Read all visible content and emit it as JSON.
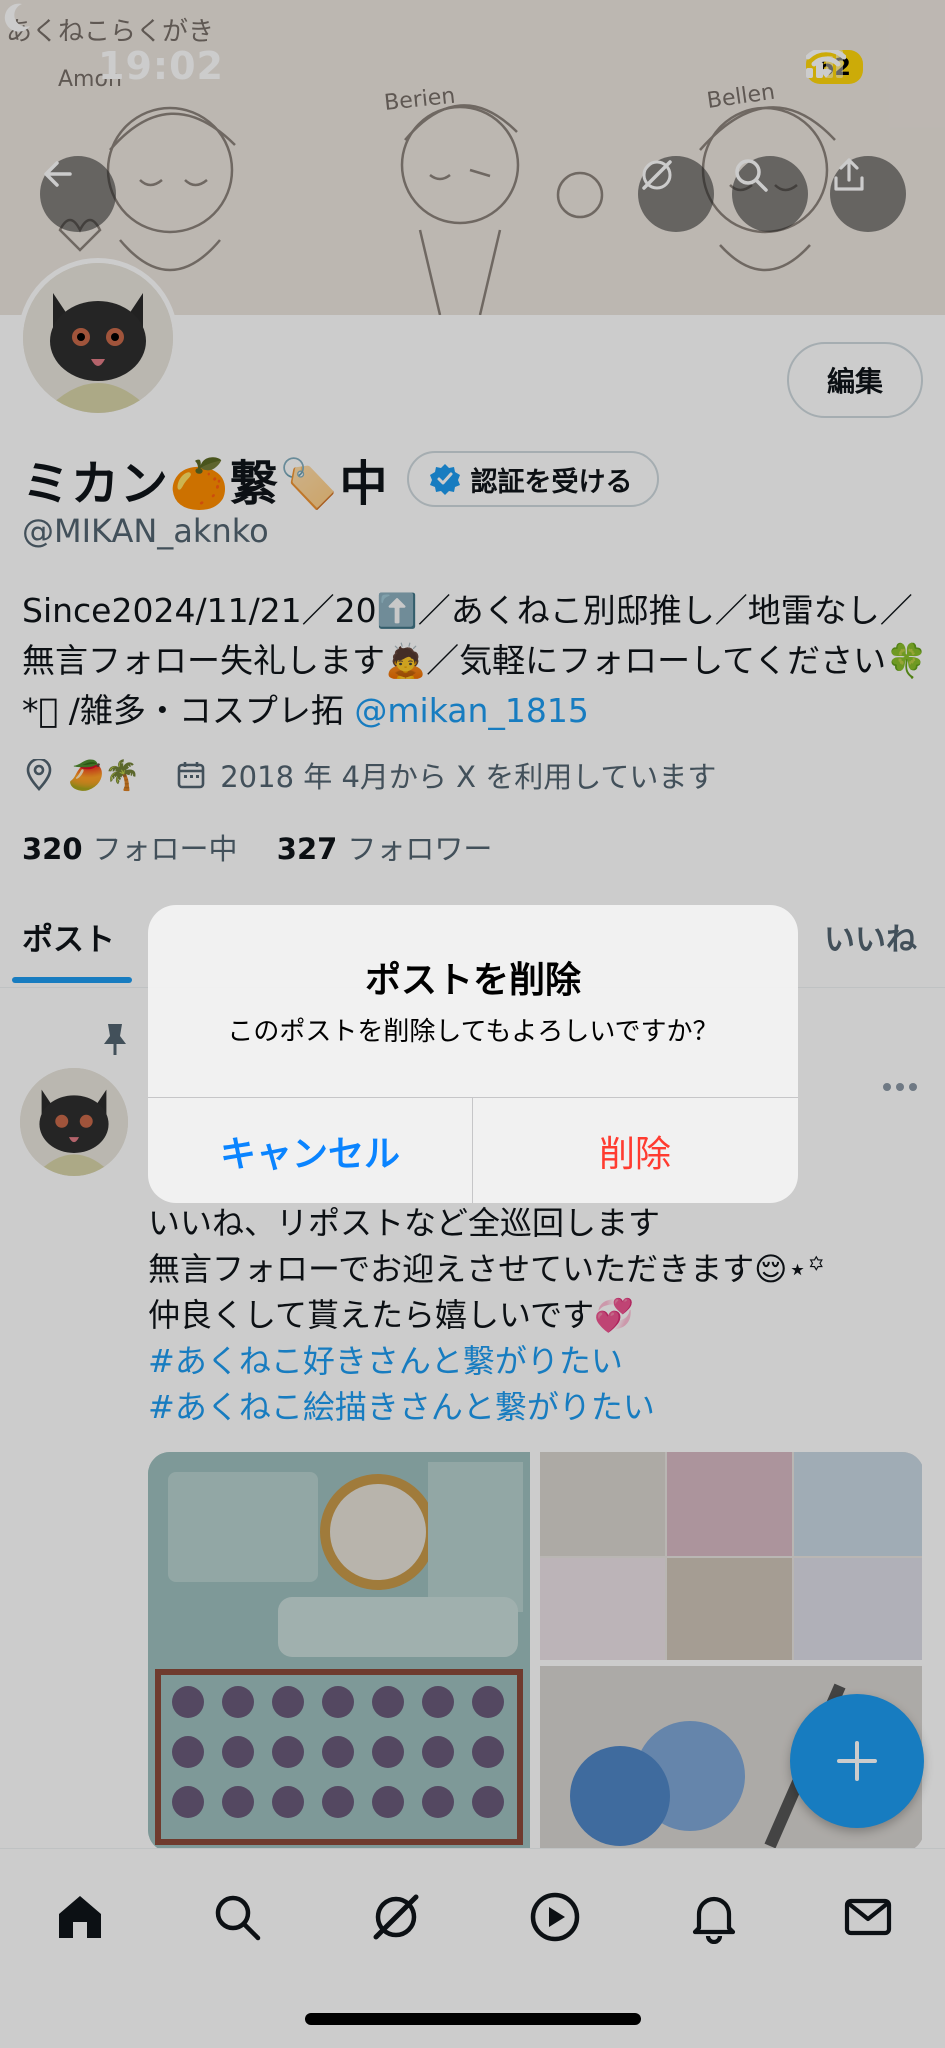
{
  "status_bar": {
    "time": "19:02",
    "battery": "62"
  },
  "banner": {
    "doodle_texts": [
      "あくねこらくがき",
      "Amon",
      "Berien",
      "Bellen"
    ]
  },
  "profile": {
    "name": "ミカン🍊繋🏷️中",
    "verify_label": "認証を受ける",
    "edit_label": "編集",
    "handle": "@MIKAN_aknko",
    "bio_text": "Since2024/11/21／20⬆️／あくねこ別邸推し／地雷なし／無言フォロー失礼します🙇／気軽にフォローしてください🍀*ﾟ /雑多・コスプレ拓 ",
    "bio_link": "@mikan_1815",
    "location": "🥭🌴",
    "joined": "2018 年 4月から X を利用しています",
    "following_count": "320",
    "following_label": "フォロー中",
    "followers_count": "327",
    "followers_label": "フォロワー"
  },
  "tabs": {
    "posts": "ポスト",
    "likes": "いいね"
  },
  "post": {
    "lines": [
      "いいね、リポストなど全巡回します",
      "無言フォローでお迎えさせていただきます😌⋆꙳",
      "仲良くして貰えたら嬉しいです💞"
    ],
    "hashtags": [
      "#あくねこ好きさんと繋がりたい",
      " #あくねこ絵描きさんと繋がりたい"
    ]
  },
  "dialog": {
    "title": "ポストを削除",
    "message": "このポストを削除してもよろしいですか？",
    "cancel": "キャンセル",
    "delete": "削除"
  },
  "colors": {
    "accent": "#1d9bf0",
    "danger": "#ff3b30",
    "ios_blue": "#0a84ff",
    "battery": "#ffd60a"
  },
  "icons": [
    "back-arrow-icon",
    "grok-icon",
    "search-icon",
    "share-icon",
    "verified-badge-icon",
    "location-icon",
    "calendar-icon",
    "pin-icon",
    "more-icon",
    "plus-icon",
    "home-icon",
    "explore-icon",
    "play-icon",
    "bell-icon",
    "mail-icon"
  ]
}
